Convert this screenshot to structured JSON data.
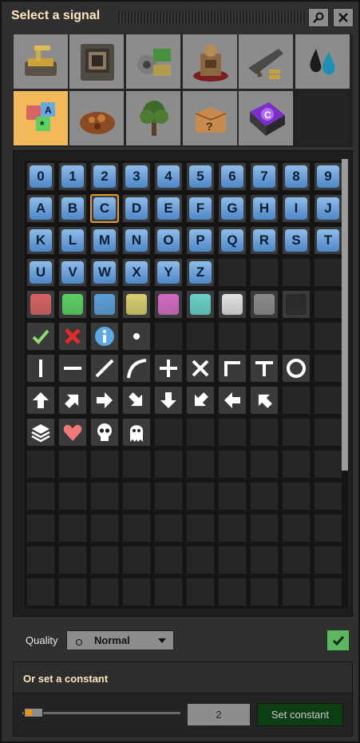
{
  "window": {
    "title": "Select a signal"
  },
  "group_tabs": [
    {
      "name": "logistics",
      "selected": false
    },
    {
      "name": "production",
      "selected": false
    },
    {
      "name": "intermediates",
      "selected": false
    },
    {
      "name": "space",
      "selected": false
    },
    {
      "name": "combat",
      "selected": false
    },
    {
      "name": "fluids",
      "selected": false
    },
    {
      "name": "signals",
      "selected": true
    },
    {
      "name": "enemies",
      "selected": false
    },
    {
      "name": "environment",
      "selected": false
    },
    {
      "name": "unsorted",
      "selected": false
    },
    {
      "name": "other",
      "selected": false
    }
  ],
  "signal_rows": [
    [
      "0",
      "1",
      "2",
      "3",
      "4",
      "5",
      "6",
      "7",
      "8",
      "9"
    ],
    [
      "A",
      "B",
      "C",
      "D",
      "E",
      "F",
      "G",
      "H",
      "I",
      "J"
    ],
    [
      "K",
      "L",
      "M",
      "N",
      "O",
      "P",
      "Q",
      "R",
      "S",
      "T"
    ],
    [
      "U",
      "V",
      "W",
      "X",
      "Y",
      "Z"
    ]
  ],
  "selected_signal": "C",
  "colors": [
    {
      "name": "red",
      "hex": "#d76363"
    },
    {
      "name": "green",
      "hex": "#5cd162"
    },
    {
      "name": "blue",
      "hex": "#5a9fdb"
    },
    {
      "name": "yellow",
      "hex": "#d9cf6f"
    },
    {
      "name": "pink",
      "hex": "#d46bc4"
    },
    {
      "name": "cyan",
      "hex": "#68d3cc"
    },
    {
      "name": "white",
      "hex": "#e1e1e1"
    },
    {
      "name": "grey",
      "hex": "#8a8a8a"
    },
    {
      "name": "black",
      "hex": "#2a2a2a"
    }
  ],
  "info_icons": [
    "check-icon",
    "deny-icon",
    "info-icon",
    "dot-icon"
  ],
  "shape_icons": [
    "vertical-line-icon",
    "horizontal-line-icon",
    "diagonal-line-icon",
    "curve-icon",
    "plus-icon",
    "cross-icon",
    "corner-icon",
    "t-shape-icon",
    "circle-icon"
  ],
  "arrow_icons": [
    "arrow-up-icon",
    "arrow-up-right-icon",
    "arrow-right-icon",
    "arrow-down-right-icon",
    "arrow-down-icon",
    "arrow-down-left-icon",
    "arrow-left-icon",
    "arrow-up-left-icon"
  ],
  "misc_icons": [
    "layers-icon",
    "heart-icon",
    "skull-icon",
    "ghost-icon"
  ],
  "quality": {
    "label": "Quality",
    "value": "Normal"
  },
  "constant": {
    "header": "Or set a constant",
    "value": "2",
    "button": "Set constant"
  },
  "accent": "#e39827"
}
